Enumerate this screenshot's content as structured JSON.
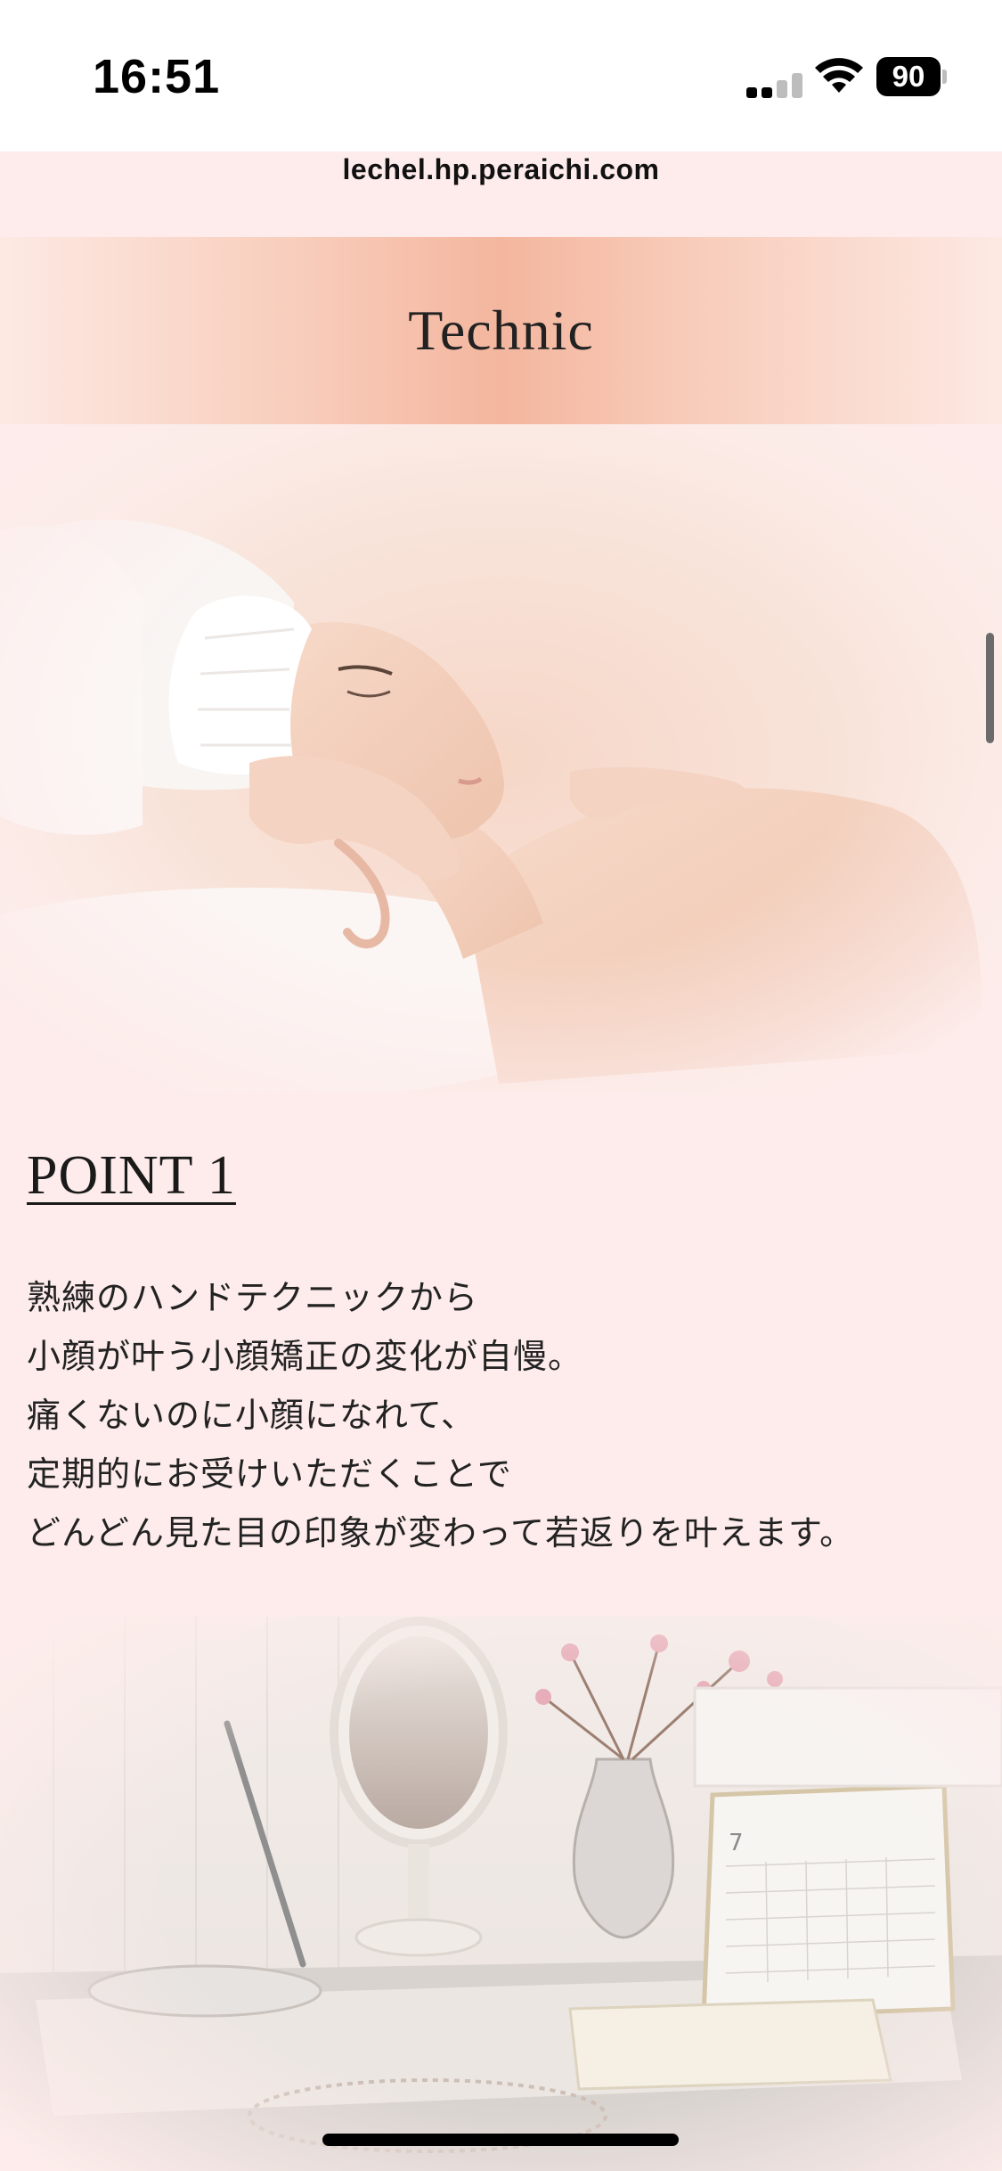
{
  "status_bar": {
    "time": "16:51",
    "battery_level": "90",
    "icons": [
      "signal-icon",
      "wifi-icon",
      "battery-icon"
    ]
  },
  "browser": {
    "url": "lechel.hp.peraichi.com"
  },
  "section": {
    "title": "Technic"
  },
  "point": {
    "title": "POINT 1",
    "lines": [
      "熟練のハンドテクニックから",
      "小顔が叶う小顔矯正の変化が自慢。",
      "痛くないのに小顔になれて、",
      "定期的にお受けいただくことで",
      "どんどん見た目の印象が変わって若返りを叶えます。"
    ]
  },
  "images": {
    "hero": "facial-massage-photo",
    "desk": "vanity-desk-photo",
    "calendar_month": "7"
  },
  "colors": {
    "page_background": "#fdeceb",
    "header_gradient_center": "#f4b69e",
    "header_gradient_edge": "#fde9e3",
    "text": "#222222"
  }
}
